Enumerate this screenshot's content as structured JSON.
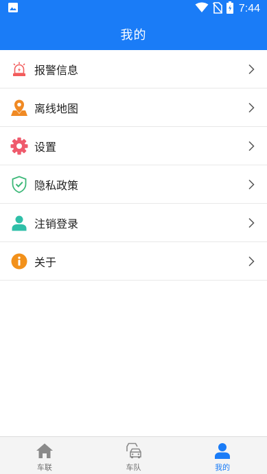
{
  "status_bar": {
    "time": "7:44",
    "icons": [
      "image-icon",
      "wifi-icon",
      "no-sim-icon",
      "battery-icon"
    ]
  },
  "header": {
    "title": "我的"
  },
  "menu": {
    "items": [
      {
        "label": "报警信息",
        "icon": "alarm-icon"
      },
      {
        "label": "离线地图",
        "icon": "map-pin-icon"
      },
      {
        "label": "设置",
        "icon": "gear-icon"
      },
      {
        "label": "隐私政策",
        "icon": "shield-check-icon"
      },
      {
        "label": "注销登录",
        "icon": "user-icon"
      },
      {
        "label": "关于",
        "icon": "info-icon"
      }
    ]
  },
  "bottom_nav": {
    "items": [
      {
        "label": "车联",
        "icon": "home-icon",
        "active": false
      },
      {
        "label": "车队",
        "icon": "cars-icon",
        "active": false
      },
      {
        "label": "我的",
        "icon": "person-icon",
        "active": true
      }
    ]
  },
  "colors": {
    "primary": "#1a7cf7",
    "alarm": "#f25c5c",
    "map": "#f08a24",
    "settings": "#ef5a6c",
    "privacy": "#3cb878",
    "logout": "#2fbfa8",
    "about": "#f2911b",
    "nav_inactive": "#8a8a8a"
  }
}
